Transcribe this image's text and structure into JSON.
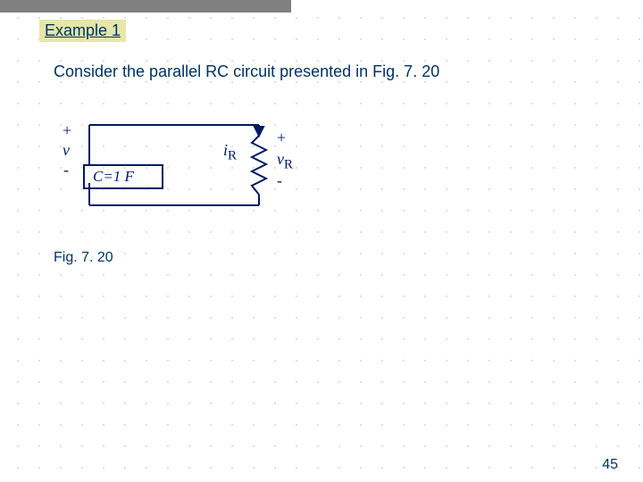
{
  "example_title": "Example 1",
  "description": "Consider the parallel RC circuit presented in Fig. 7. 20",
  "figure_caption": "Fig. 7. 20",
  "page_number": "45",
  "circuit": {
    "v_plus": "+",
    "v_sym": "v",
    "v_minus": "-",
    "cap_label": "C=1 F",
    "iR_i": "i",
    "iR_sub": "R",
    "vR_plus": "+",
    "vR_v": "v",
    "vR_sub": "R",
    "vR_minus": "-"
  }
}
